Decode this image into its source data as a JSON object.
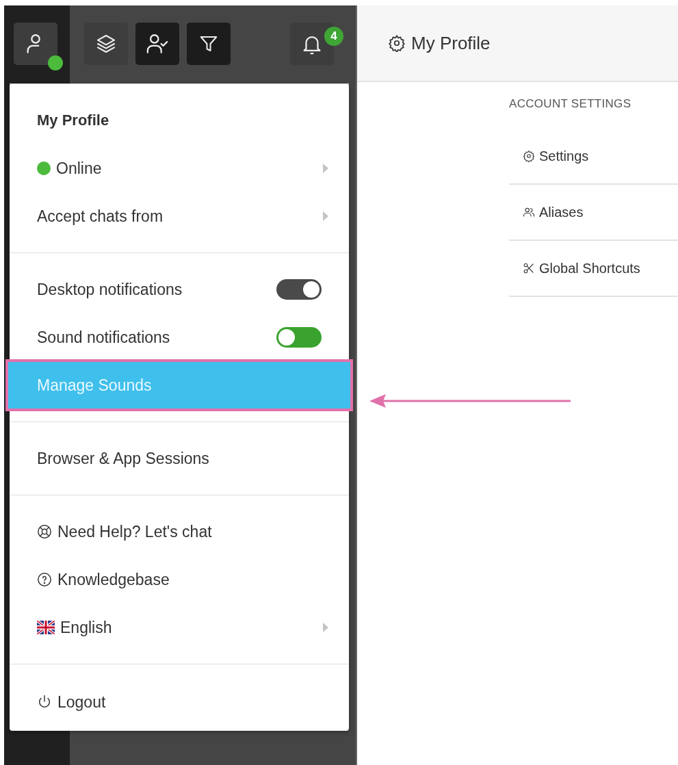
{
  "toolbar": {
    "buttons": [
      {
        "kind": "profile",
        "selected": true
      },
      {
        "kind": "layers",
        "selected": true
      },
      {
        "kind": "user-check",
        "selected": false
      },
      {
        "kind": "filter",
        "selected": false
      },
      {
        "kind": "notifications",
        "selected": true,
        "badge": "4"
      }
    ]
  },
  "menu": {
    "sections": [
      {
        "items": [
          {
            "kind": "heading",
            "label": "My Profile"
          },
          {
            "kind": "status",
            "label": "Online",
            "color": "#4cbb3c"
          },
          {
            "kind": "submenu",
            "label": "Accept chats from"
          }
        ]
      },
      {
        "items": [
          {
            "kind": "toggle",
            "label": "Desktop notifications",
            "on": true,
            "color": "#4a4a4a"
          },
          {
            "kind": "toggle",
            "label": "Sound notifications",
            "on": false,
            "color": "#3aa22e"
          },
          {
            "kind": "link",
            "label": "Manage Sounds",
            "selected": true,
            "annotated": true
          }
        ]
      },
      {
        "items": [
          {
            "kind": "link",
            "label": "Browser & App Sessions",
            "selected": false
          }
        ]
      },
      {
        "items": [
          {
            "kind": "help-chat",
            "label": "Need Help? Let's chat"
          },
          {
            "kind": "knowledgebase",
            "label": "Knowledgebase"
          },
          {
            "kind": "language",
            "label": "English"
          }
        ]
      },
      {
        "items": [
          {
            "kind": "logout",
            "label": "Logout"
          }
        ]
      }
    ]
  },
  "header": {
    "title": "My Profile"
  },
  "account_settings": {
    "heading": "ACCOUNT SETTINGS",
    "items": [
      {
        "kind": "settings",
        "label": "Settings"
      },
      {
        "kind": "aliases",
        "label": "Aliases"
      },
      {
        "kind": "shortcuts",
        "label": "Global Shortcuts"
      }
    ]
  }
}
